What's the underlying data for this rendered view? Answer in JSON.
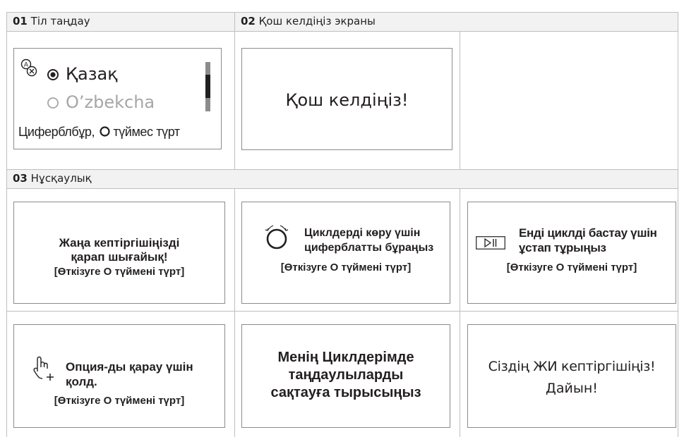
{
  "sections": {
    "s01": {
      "number": "01",
      "title": "Тіл таңдау"
    },
    "s02": {
      "number": "02",
      "title": "Қош келдіңіз экраны"
    },
    "s03": {
      "number": "03",
      "title": "Нұсқаулық"
    }
  },
  "language_screen": {
    "selected_language": "Қазақ",
    "other_language": "O’zbekcha",
    "hint_prefix": "Циферблбұр,",
    "hint_suffix": "түймес түрт"
  },
  "welcome_screen": {
    "text": "Қош келдіңіз!"
  },
  "guide_screens": {
    "g1": {
      "line1": "Жаңа кептіргішіңізді",
      "line2": "қарап шығайық!",
      "line3": "[Өткізуге О түймені түрт]"
    },
    "g2": {
      "line1": "Циклдерді көру үшін",
      "line2": "циферблатты бұраңыз",
      "line3": "[Өткізуге О түймені түрт]"
    },
    "g3": {
      "line1": "Енді циклді бастау үшін",
      "line2": "ұстап тұрыңыз",
      "line3": "[Өткізуге О түймені түрт]"
    },
    "g4": {
      "line1": "Опция-ды қарау үшін",
      "line2": "қолд.",
      "line3": "[Өткізуге О түймені түрт]"
    },
    "g5": {
      "line1": "Менің Циклдерімде",
      "line2": "таңдаулыларды",
      "line3": "сақтауға тырысыңыз"
    },
    "g6": {
      "line1": "Сіздің ЖИ кептіргішіңіз!",
      "line2": "Дайын!"
    }
  },
  "colors": {
    "text": "#231f20",
    "grid": "#bfbfbf",
    "header_bg": "#f2f2f2",
    "inactive": "#a6a6a6"
  }
}
